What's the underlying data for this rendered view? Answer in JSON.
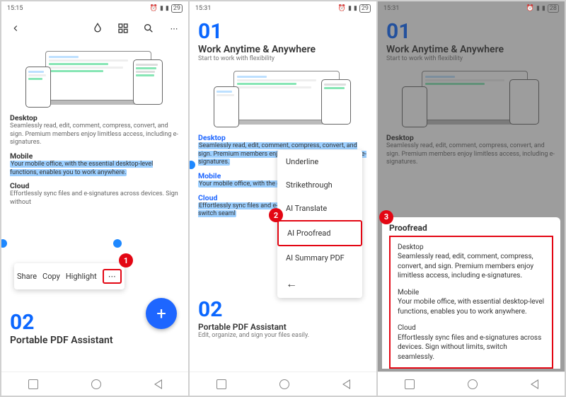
{
  "panels": [
    {
      "status_time": "15:15",
      "status_batt": "29",
      "big_num": "02",
      "sec2_title": "Portable PDF Assistant",
      "desktop": {
        "label": "Desktop",
        "text": "Seamlessly read, edit, comment, compress, convert, and sign. Premium members enjoy limitless access, including e-signatures."
      },
      "mobile": {
        "label": "Mobile",
        "text": "Your mobile office, with the essential desktop-level functions, enables you to work anywhere."
      },
      "cloud": {
        "label": "Cloud",
        "text": "Effortlessly sync files and e-signatures across devices. Sign without"
      },
      "ctx": {
        "share": "Share",
        "copy": "Copy",
        "highlight": "Highlight",
        "more": "⋯"
      },
      "badge": "1"
    },
    {
      "status_time": "15:31",
      "status_batt": "29",
      "big_num": "01",
      "sec_title": "Work  Anytime & Anywhere",
      "sec_sub": "Start to work with flexibility",
      "big_num2": "02",
      "sec2_title": "Portable PDF Assistant",
      "sec2_sub": "Edit, organize, and sign your files easily.",
      "desktop": {
        "label": "Desktop",
        "text": "Seamlessly read, edit, comment, compress, convert, and sign. Premium members enjoy limitless access, including e-signatures."
      },
      "mobile": {
        "label": "Mobile",
        "text": "Your mobile office, with the essential"
      },
      "cloud": {
        "label": "Cloud",
        "text": "Effortlessly sync files and e-signatures without limits, switch seaml"
      },
      "menu": {
        "underline": "Underline",
        "strikethrough": "Strikethrough",
        "ai_translate": "AI Translate",
        "ai_proofread": "AI Proofread",
        "ai_summary": "AI Summary PDF",
        "back": "←"
      },
      "badge": "2"
    },
    {
      "status_time": "15:31",
      "status_batt": "28",
      "big_num": "01",
      "sec_title": "Work  Anytime & Anywhere",
      "sec_sub": "Start to work with flexibility",
      "desktop": {
        "label": "Desktop",
        "text": "Seamlessly read, edit, comment, compress, convert, and sign. Premium members enjoy limitless access, including e-signatures."
      },
      "proofread": {
        "title": "Proofread",
        "desktop_label": "Desktop",
        "desktop_text": "Seamlessly read, edit, comment, compress, convert, and sign. Premium members enjoy limitless access, including e-signatures.",
        "mobile_label": "Mobile",
        "mobile_text": "Your mobile office, with essential desktop-level functions, enables you to work anywhere.",
        "cloud_label": "Cloud",
        "cloud_text": "Effortlessly sync files and e-signatures across devices. Sign without limits, switch seamlessly."
      },
      "badge": "3"
    }
  ]
}
